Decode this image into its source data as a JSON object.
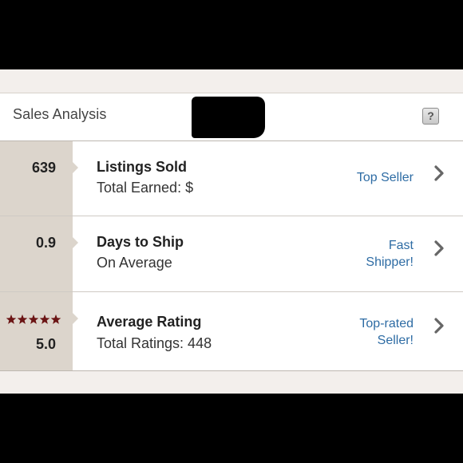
{
  "header": {
    "title": "Sales Analysis",
    "help_label": "?"
  },
  "rows": [
    {
      "stat": "639",
      "label": "Listings Sold",
      "sublabel": "Total Earned: $",
      "badge_lines": [
        "Top Seller"
      ],
      "icon": "chevron-right-icon"
    },
    {
      "stat": "0.9",
      "label": "Days to Ship",
      "sublabel": "On Average",
      "badge_lines": [
        "Fast",
        "Shipper!"
      ],
      "icon": "chevron-right-icon"
    },
    {
      "stat": "5.0",
      "stars": 5,
      "label": "Average Rating",
      "sublabel": "Total Ratings: 448",
      "badge_lines": [
        "Top-rated",
        "Seller!"
      ],
      "icon": "chevron-right-icon"
    }
  ],
  "colors": {
    "accent_link": "#2e6ca4",
    "stat_panel": "#dcd5cc",
    "star": "#6b1414"
  }
}
